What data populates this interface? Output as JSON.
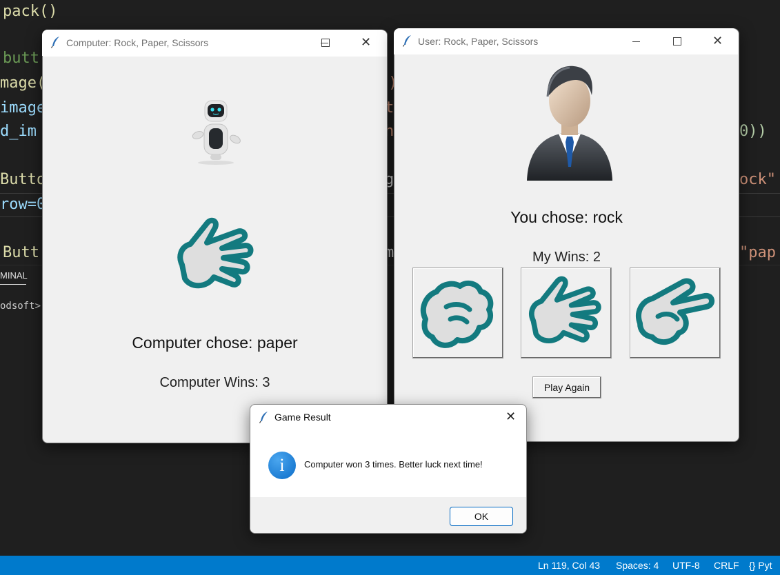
{
  "editor": {
    "lines": {
      "l1": "pack()",
      "l2": "butt",
      "l3": "mage(",
      "l4": "image",
      "l5": "d_im",
      "l6": "Butto",
      "l7": "row=0",
      "l8": "Butt",
      "r3": "s)",
      "r4": "t:",
      "r5": "he",
      "r5b": "0))",
      "r6": "g.",
      "r6b": "ock\"",
      "r8": "m",
      "r8b": "\"pap"
    },
    "terminal_tab": "MINAL",
    "terminal_line": "odsoft>"
  },
  "statusbar": {
    "position": "Ln 119, Col 43",
    "spaces": "Spaces: 4",
    "encoding": "UTF-8",
    "eol": "CRLF",
    "lang": "{} Pyt"
  },
  "computer_window": {
    "title": "Computer: Rock, Paper, Scissors",
    "choice_text": "Computer chose: paper",
    "wins_text": "Computer Wins: 3"
  },
  "user_window": {
    "title": "User: Rock, Paper, Scissors",
    "choice_text": "You chose: rock",
    "wins_text": "My Wins: 2",
    "play_again_label": "Play Again"
  },
  "dialog": {
    "title": "Game Result",
    "message": "Computer won 3 times. Better luck next time!",
    "ok_label": "OK",
    "info_glyph": "i"
  },
  "colors": {
    "hand_stroke": "#137a7f",
    "hand_fill": "#dedede",
    "accent": "#007acc"
  },
  "icons": {
    "feather": "feather-icon",
    "info": "info-icon",
    "robot": "robot-icon",
    "user": "user-avatar-icon"
  }
}
